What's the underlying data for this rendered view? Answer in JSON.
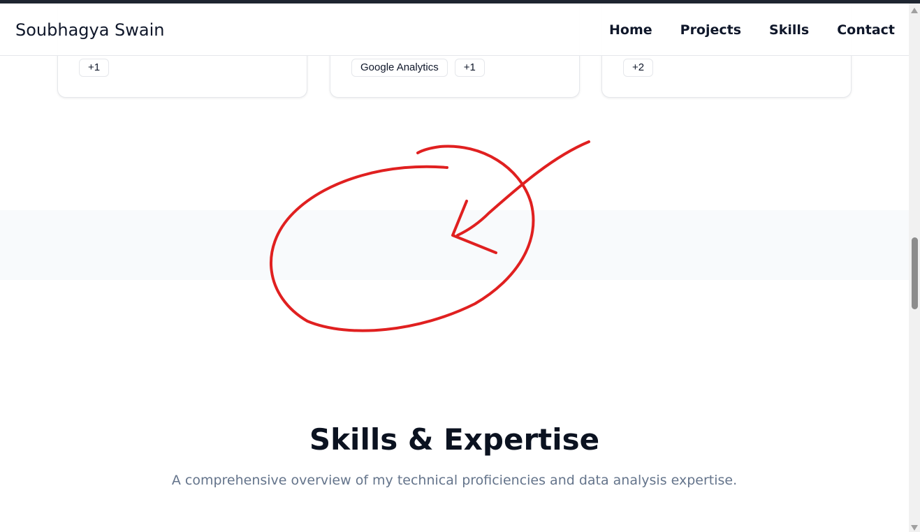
{
  "header": {
    "brand": "Soubhagya Swain",
    "nav": [
      "Home",
      "Projects",
      "Skills",
      "Contact"
    ]
  },
  "cards": [
    {
      "tags": [
        "+1"
      ]
    },
    {
      "tags": [
        "Google Analytics",
        "+1"
      ]
    },
    {
      "tags": [
        "+2"
      ]
    }
  ],
  "skills": {
    "title": "Skills & Expertise",
    "subtitle": "A comprehensive overview of my technical proficiencies and data analysis expertise."
  },
  "annotation": {
    "color": "#e02020",
    "shape": "circle-with-arrow"
  }
}
